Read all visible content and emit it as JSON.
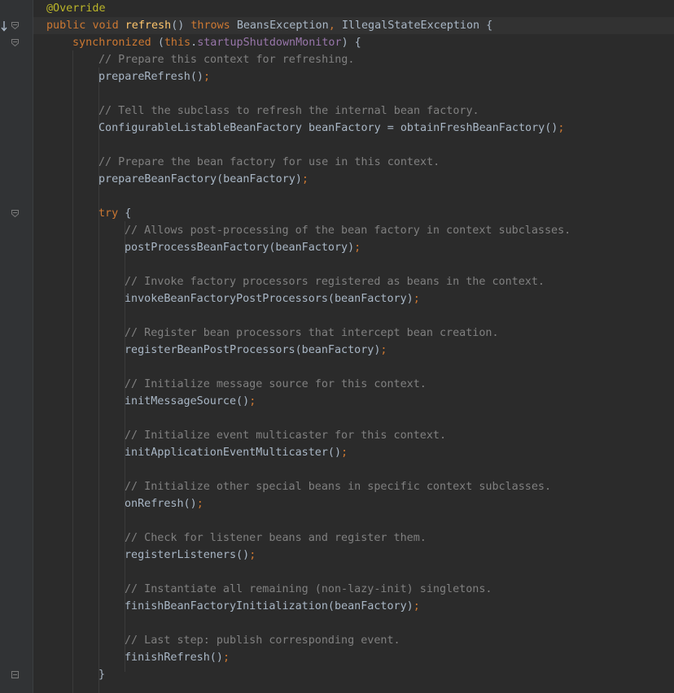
{
  "editor": {
    "lines": [
      {
        "indent": 0,
        "tokens": [
          {
            "t": "@Override",
            "c": "ann"
          }
        ]
      },
      {
        "indent": 0,
        "tokens": [
          {
            "t": "public ",
            "c": "kw"
          },
          {
            "t": "void ",
            "c": "kw"
          },
          {
            "t": "refresh",
            "c": "fn"
          },
          {
            "t": "() ",
            "c": "pl"
          },
          {
            "t": "throws ",
            "c": "kw"
          },
          {
            "t": "BeansException",
            "c": "pl"
          },
          {
            "t": ", ",
            "c": "punc"
          },
          {
            "t": "IllegalStateException {",
            "c": "pl"
          }
        ]
      },
      {
        "indent": 1,
        "tokens": [
          {
            "t": "synchronized ",
            "c": "kw"
          },
          {
            "t": "(",
            "c": "pl"
          },
          {
            "t": "this",
            "c": "kw"
          },
          {
            "t": ".",
            "c": "pl"
          },
          {
            "t": "startupShutdownMonitor",
            "c": "fld"
          },
          {
            "t": ") {",
            "c": "pl"
          }
        ]
      },
      {
        "indent": 2,
        "tokens": [
          {
            "t": "// Prepare this context for refreshing.",
            "c": "cm"
          }
        ]
      },
      {
        "indent": 2,
        "tokens": [
          {
            "t": "prepareRefresh()",
            "c": "pl"
          },
          {
            "t": ";",
            "c": "punc"
          }
        ]
      },
      {
        "indent": 0,
        "tokens": []
      },
      {
        "indent": 2,
        "tokens": [
          {
            "t": "// Tell the subclass to refresh the internal bean factory.",
            "c": "cm"
          }
        ]
      },
      {
        "indent": 2,
        "tokens": [
          {
            "t": "ConfigurableListableBeanFactory beanFactory = obtainFreshBeanFactory()",
            "c": "pl"
          },
          {
            "t": ";",
            "c": "punc"
          }
        ]
      },
      {
        "indent": 0,
        "tokens": []
      },
      {
        "indent": 2,
        "tokens": [
          {
            "t": "// Prepare the bean factory for use in this context.",
            "c": "cm"
          }
        ]
      },
      {
        "indent": 2,
        "tokens": [
          {
            "t": "prepareBeanFactory(beanFactory)",
            "c": "pl"
          },
          {
            "t": ";",
            "c": "punc"
          }
        ]
      },
      {
        "indent": 0,
        "tokens": []
      },
      {
        "indent": 2,
        "tokens": [
          {
            "t": "try ",
            "c": "kw"
          },
          {
            "t": "{",
            "c": "pl"
          }
        ]
      },
      {
        "indent": 3,
        "tokens": [
          {
            "t": "// Allows post-processing of the bean factory in context subclasses.",
            "c": "cm"
          }
        ]
      },
      {
        "indent": 3,
        "tokens": [
          {
            "t": "postProcessBeanFactory(beanFactory)",
            "c": "pl"
          },
          {
            "t": ";",
            "c": "punc"
          }
        ]
      },
      {
        "indent": 0,
        "tokens": []
      },
      {
        "indent": 3,
        "tokens": [
          {
            "t": "// Invoke factory processors registered as beans in the context.",
            "c": "cm"
          }
        ]
      },
      {
        "indent": 3,
        "tokens": [
          {
            "t": "invokeBeanFactoryPostProcessors(beanFactory)",
            "c": "pl"
          },
          {
            "t": ";",
            "c": "punc"
          }
        ]
      },
      {
        "indent": 0,
        "tokens": []
      },
      {
        "indent": 3,
        "tokens": [
          {
            "t": "// Register bean processors that intercept bean creation.",
            "c": "cm"
          }
        ]
      },
      {
        "indent": 3,
        "tokens": [
          {
            "t": "registerBeanPostProcessors(beanFactory)",
            "c": "pl"
          },
          {
            "t": ";",
            "c": "punc"
          }
        ]
      },
      {
        "indent": 0,
        "tokens": []
      },
      {
        "indent": 3,
        "tokens": [
          {
            "t": "// Initialize message source for this context.",
            "c": "cm"
          }
        ]
      },
      {
        "indent": 3,
        "tokens": [
          {
            "t": "initMessageSource()",
            "c": "pl"
          },
          {
            "t": ";",
            "c": "punc"
          }
        ]
      },
      {
        "indent": 0,
        "tokens": []
      },
      {
        "indent": 3,
        "tokens": [
          {
            "t": "// Initialize event multicaster for this context.",
            "c": "cm"
          }
        ]
      },
      {
        "indent": 3,
        "tokens": [
          {
            "t": "initApplicationEventMulticaster()",
            "c": "pl"
          },
          {
            "t": ";",
            "c": "punc"
          }
        ]
      },
      {
        "indent": 0,
        "tokens": []
      },
      {
        "indent": 3,
        "tokens": [
          {
            "t": "// Initialize other special beans in specific context subclasses.",
            "c": "cm"
          }
        ]
      },
      {
        "indent": 3,
        "tokens": [
          {
            "t": "onRefresh()",
            "c": "pl"
          },
          {
            "t": ";",
            "c": "punc"
          }
        ]
      },
      {
        "indent": 0,
        "tokens": []
      },
      {
        "indent": 3,
        "tokens": [
          {
            "t": "// Check for listener beans and register them.",
            "c": "cm"
          }
        ]
      },
      {
        "indent": 3,
        "tokens": [
          {
            "t": "registerListeners()",
            "c": "pl"
          },
          {
            "t": ";",
            "c": "punc"
          }
        ]
      },
      {
        "indent": 0,
        "tokens": []
      },
      {
        "indent": 3,
        "tokens": [
          {
            "t": "// Instantiate all remaining (non-lazy-init) singletons.",
            "c": "cm"
          }
        ]
      },
      {
        "indent": 3,
        "tokens": [
          {
            "t": "finishBeanFactoryInitialization(beanFactory)",
            "c": "pl"
          },
          {
            "t": ";",
            "c": "punc"
          }
        ]
      },
      {
        "indent": 0,
        "tokens": []
      },
      {
        "indent": 3,
        "tokens": [
          {
            "t": "// Last step: publish corresponding event.",
            "c": "cm"
          }
        ]
      },
      {
        "indent": 3,
        "tokens": [
          {
            "t": "finishRefresh()",
            "c": "pl"
          },
          {
            "t": ";",
            "c": "punc"
          }
        ]
      },
      {
        "indent": 2,
        "tokens": [
          {
            "t": "}",
            "c": "pl"
          }
        ]
      }
    ],
    "fold_marker_lines": [
      1,
      2,
      12,
      39
    ],
    "gutter_icons": [
      "implements-method-icon"
    ],
    "colors": {
      "background": "#2b2b2b",
      "gutter": "#313335",
      "keyword": "#cc7832",
      "annotation": "#bbb529",
      "comment": "#808080",
      "field": "#9876aa",
      "method_declaration": "#ffc66d",
      "plain": "#a9b7c6"
    }
  }
}
